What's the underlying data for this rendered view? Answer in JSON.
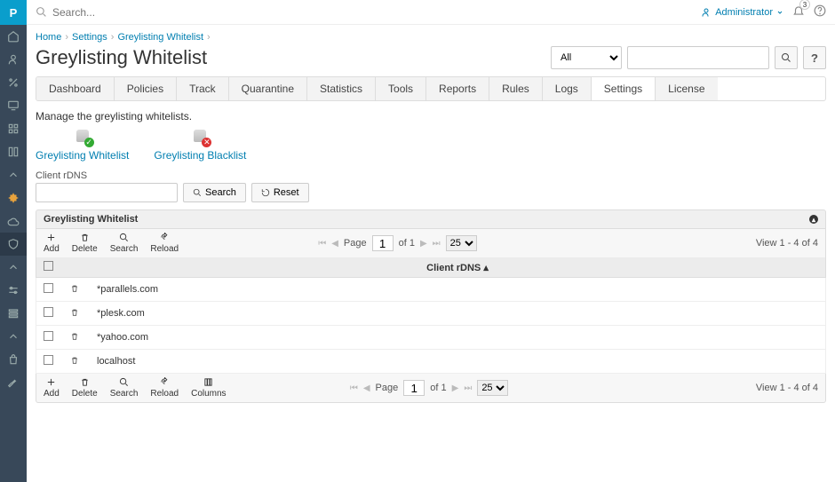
{
  "topbar": {
    "search_placeholder": "Search...",
    "user": "Administrator",
    "notif_count": "3"
  },
  "breadcrumb": {
    "home": "Home",
    "settings": "Settings",
    "current": "Greylisting Whitelist"
  },
  "page_title": "Greylisting Whitelist",
  "header_filter": {
    "option": "All"
  },
  "tabs": {
    "dashboard": "Dashboard",
    "policies": "Policies",
    "track": "Track",
    "quarantine": "Quarantine",
    "statistics": "Statistics",
    "tools": "Tools",
    "reports": "Reports",
    "rules": "Rules",
    "logs": "Logs",
    "settings": "Settings",
    "license": "License"
  },
  "subdesc": "Manage the greylisting whitelists.",
  "lists": {
    "whitelist": "Greylisting Whitelist",
    "blacklist": "Greylisting Blacklist"
  },
  "filter": {
    "label": "Client rDNS",
    "search": "Search",
    "reset": "Reset"
  },
  "panel_title": "Greylisting Whitelist",
  "toolbar": {
    "add": "Add",
    "delete": "Delete",
    "search": "Search",
    "reload": "Reload",
    "columns": "Columns"
  },
  "pager": {
    "page_label": "Page",
    "page_value": "1",
    "of_label": "of 1",
    "per_page": "25"
  },
  "view_info": "View 1 - 4 of 4",
  "col_rdns": "Client rDNS",
  "rows": [
    {
      "rdns": "*parallels.com"
    },
    {
      "rdns": "*plesk.com"
    },
    {
      "rdns": "*yahoo.com"
    },
    {
      "rdns": "localhost"
    }
  ]
}
